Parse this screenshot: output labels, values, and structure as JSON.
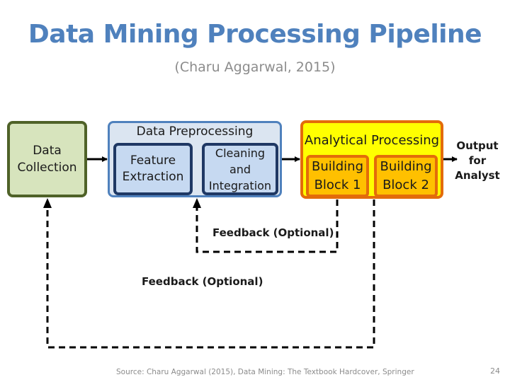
{
  "slide": {
    "title": "Data Mining Processing Pipeline",
    "subtitle": "(Charu Aggarwal, 2015)",
    "source": "Source: Charu Aggarwal (2015), Data Mining: The Textbook Hardcover, Springer",
    "page_number": "24"
  },
  "pipeline": {
    "data_collection": {
      "line1": "Data",
      "line2": "Collection"
    },
    "preprocessing": {
      "label": "Data Preprocessing",
      "feature_extraction": {
        "line1": "Feature",
        "line2": "Extraction"
      },
      "cleaning": {
        "line1": "Cleaning",
        "line2": "and",
        "line3": "Integration"
      }
    },
    "analytical": {
      "label": "Analytical Processing",
      "block1": {
        "line1": "Building",
        "line2": "Block 1"
      },
      "block2": {
        "line1": "Building",
        "line2": "Block 2"
      }
    },
    "output": {
      "line1": "Output",
      "line2": "for",
      "line3": "Analyst"
    },
    "feedback_inner": "Feedback (Optional)",
    "feedback_outer": "Feedback (Optional)"
  },
  "colors": {
    "title": "#4f81bd",
    "collection_fill": "#d7e4bd",
    "collection_border": "#4f6228",
    "prep_fill": "#dbe5f1",
    "prep_border": "#4f81bd",
    "prep_inner_fill": "#c6d9f1",
    "prep_inner_border": "#1f3864",
    "analytical_fill": "#ffff00",
    "analytical_border": "#e36c0a",
    "block_fill": "#ffc000"
  }
}
